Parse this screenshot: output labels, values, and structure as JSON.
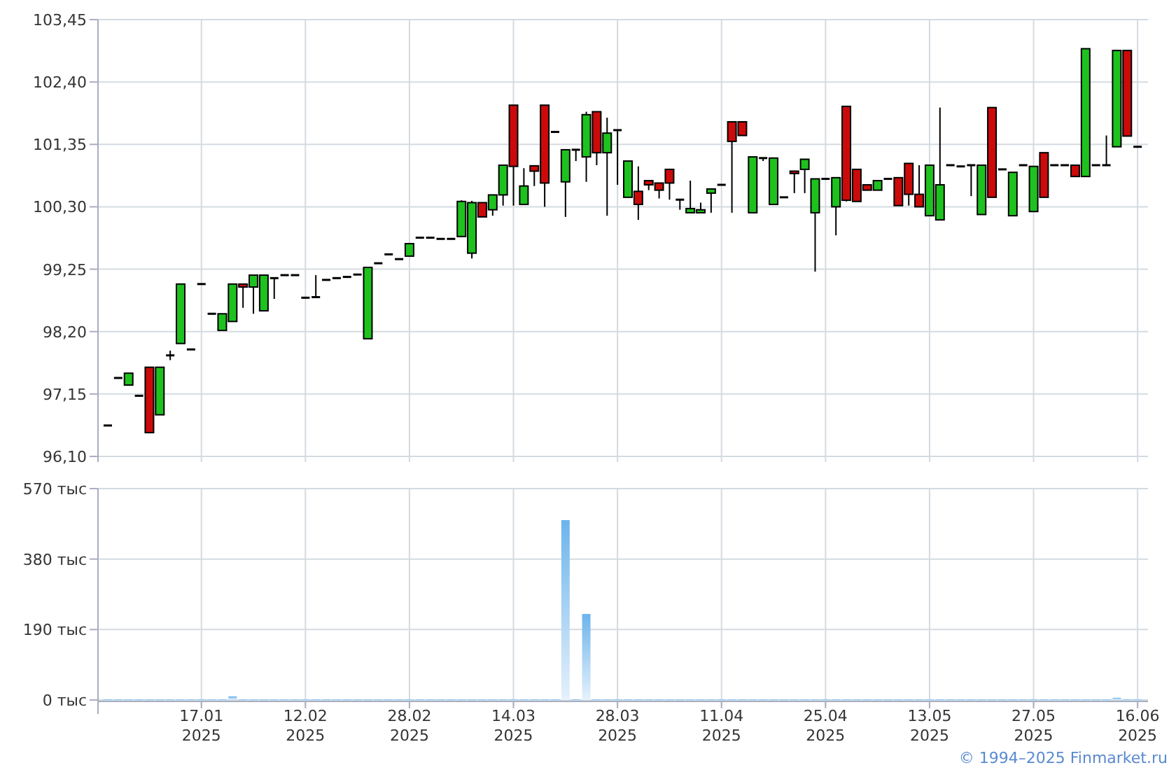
{
  "price_chart": {
    "chart_data": {
      "type": "candlestick",
      "grid": true,
      "ylim": [
        96.1,
        103.45
      ],
      "yticks": [
        {
          "value": 103.45,
          "label": "103,45"
        },
        {
          "value": 102.4,
          "label": "102,40"
        },
        {
          "value": 101.35,
          "label": "101,35"
        },
        {
          "value": 100.3,
          "label": "100,30"
        },
        {
          "value": 99.25,
          "label": "99,25"
        },
        {
          "value": 98.2,
          "label": "98,20"
        },
        {
          "value": 97.15,
          "label": "97,15"
        },
        {
          "value": 96.1,
          "label": "96,10"
        }
      ],
      "categories": [
        null,
        null,
        null,
        null,
        null,
        null,
        null,
        null,
        null,
        null,
        null,
        null,
        null,
        null,
        null,
        null,
        null,
        null,
        null,
        null,
        null,
        null,
        null,
        null,
        null,
        null,
        null,
        null,
        null,
        null,
        null,
        null,
        null,
        null,
        null,
        null,
        null,
        null,
        null,
        null,
        null,
        null,
        null,
        null,
        null,
        null,
        null,
        null,
        null,
        null,
        null,
        null,
        null,
        null,
        null,
        null,
        null,
        null,
        null,
        null,
        null,
        null,
        null,
        null,
        null,
        null,
        null,
        null,
        null,
        null,
        null,
        null,
        null,
        null,
        null,
        null,
        null,
        null,
        null,
        null,
        null,
        null,
        null,
        null,
        null,
        null,
        null,
        null,
        null,
        null,
        null,
        null,
        null,
        null,
        null,
        null,
        null,
        null,
        null,
        null
      ],
      "ohlc": [
        [
          96.62,
          96.62,
          96.62,
          96.62
        ],
        [
          97.42,
          97.42,
          97.42,
          97.42
        ],
        [
          97.3,
          97.5,
          97.3,
          97.5
        ],
        [
          97.12,
          97.12,
          97.12,
          97.12
        ],
        [
          97.6,
          97.6,
          96.5,
          96.5
        ],
        [
          96.8,
          97.6,
          96.8,
          97.6
        ],
        [
          97.8,
          97.88,
          97.72,
          97.8
        ],
        [
          98.0,
          99.0,
          98.0,
          99.0
        ],
        [
          97.9,
          97.9,
          97.9,
          97.9
        ],
        [
          99.0,
          99.0,
          99.0,
          99.0
        ],
        [
          98.5,
          98.5,
          98.5,
          98.5
        ],
        [
          98.22,
          98.5,
          98.22,
          98.5
        ],
        [
          98.37,
          99.0,
          98.37,
          99.0
        ],
        [
          99.0,
          99.0,
          98.6,
          98.95
        ],
        [
          98.95,
          99.15,
          98.5,
          99.15
        ],
        [
          98.55,
          99.15,
          98.55,
          99.15
        ],
        [
          99.1,
          99.1,
          98.75,
          99.1
        ],
        [
          99.15,
          99.15,
          99.15,
          99.15
        ],
        [
          99.15,
          99.15,
          99.15,
          99.15
        ],
        [
          98.77,
          98.77,
          98.77,
          98.77
        ],
        [
          98.78,
          99.15,
          98.78,
          98.78
        ],
        [
          99.07,
          99.07,
          99.07,
          99.07
        ],
        [
          99.1,
          99.1,
          99.1,
          99.1
        ],
        [
          99.12,
          99.12,
          99.12,
          99.12
        ],
        [
          99.16,
          99.16,
          99.16,
          99.16
        ],
        [
          98.08,
          99.28,
          98.08,
          99.28
        ],
        [
          99.35,
          99.35,
          99.35,
          99.35
        ],
        [
          99.5,
          99.5,
          99.5,
          99.5
        ],
        [
          99.42,
          99.42,
          99.42,
          99.42
        ],
        [
          99.47,
          99.68,
          99.47,
          99.68
        ],
        [
          99.78,
          99.78,
          99.78,
          99.78
        ],
        [
          99.78,
          99.78,
          99.78,
          99.78
        ],
        [
          99.76,
          99.76,
          99.76,
          99.76
        ],
        [
          99.76,
          99.76,
          99.76,
          99.76
        ],
        [
          99.8,
          100.41,
          99.8,
          100.39
        ],
        [
          99.52,
          100.4,
          99.43,
          100.37
        ],
        [
          100.37,
          100.37,
          100.13,
          100.13
        ],
        [
          100.25,
          100.5,
          100.15,
          100.5
        ],
        [
          100.5,
          101.0,
          100.32,
          101.0
        ],
        [
          102.01,
          102.01,
          100.32,
          100.98
        ],
        [
          100.34,
          100.95,
          100.34,
          100.65
        ],
        [
          100.99,
          101.0,
          100.65,
          100.9
        ],
        [
          102.01,
          102.01,
          100.3,
          100.7
        ],
        [
          101.56,
          101.56,
          101.56,
          101.56
        ],
        [
          100.72,
          101.26,
          100.13,
          101.26
        ],
        [
          101.26,
          101.26,
          101.07,
          101.26
        ],
        [
          101.14,
          101.9,
          100.72,
          101.85
        ],
        [
          101.9,
          101.9,
          101.0,
          101.21
        ],
        [
          101.21,
          101.8,
          100.15,
          101.54
        ],
        [
          101.59,
          101.59,
          100.67,
          101.59
        ],
        [
          100.46,
          101.07,
          100.46,
          101.07
        ],
        [
          100.56,
          100.98,
          100.08,
          100.34
        ],
        [
          100.74,
          100.74,
          100.58,
          100.67
        ],
        [
          100.7,
          100.7,
          100.44,
          100.58
        ],
        [
          100.93,
          100.93,
          100.42,
          100.7
        ],
        [
          100.42,
          100.42,
          100.25,
          100.42
        ],
        [
          100.2,
          100.74,
          100.2,
          100.27
        ],
        [
          100.2,
          100.37,
          100.2,
          100.25
        ],
        [
          100.53,
          100.6,
          100.2,
          100.6
        ],
        [
          100.67,
          100.67,
          100.67,
          100.67
        ],
        [
          101.73,
          101.73,
          100.2,
          101.4
        ],
        [
          101.73,
          101.73,
          101.5,
          101.5
        ],
        [
          100.2,
          101.14,
          100.2,
          101.14
        ],
        [
          101.12,
          101.12,
          101.07,
          101.12
        ],
        [
          100.34,
          101.12,
          100.34,
          101.12
        ],
        [
          100.46,
          100.46,
          100.46,
          100.46
        ],
        [
          100.9,
          100.9,
          100.53,
          100.86
        ],
        [
          100.93,
          101.1,
          100.53,
          101.1
        ],
        [
          100.2,
          100.77,
          99.21,
          100.77
        ],
        [
          100.77,
          100.77,
          100.77,
          100.77
        ],
        [
          100.3,
          100.79,
          99.82,
          100.79
        ],
        [
          101.99,
          101.99,
          100.39,
          100.41
        ],
        [
          100.93,
          100.93,
          100.39,
          100.39
        ],
        [
          100.67,
          100.67,
          100.58,
          100.58
        ],
        [
          100.58,
          100.74,
          100.58,
          100.74
        ],
        [
          100.77,
          100.77,
          100.77,
          100.77
        ],
        [
          100.79,
          100.79,
          100.32,
          100.32
        ],
        [
          101.03,
          101.03,
          100.32,
          100.51
        ],
        [
          100.51,
          101.0,
          100.3,
          100.3
        ],
        [
          100.15,
          101.0,
          100.15,
          101.0
        ],
        [
          100.08,
          101.97,
          100.08,
          100.67
        ],
        [
          101.0,
          101.0,
          101.0,
          101.0
        ],
        [
          100.98,
          100.98,
          100.98,
          100.98
        ],
        [
          101.0,
          101.0,
          100.48,
          101.0
        ],
        [
          100.17,
          101.0,
          100.17,
          101.0
        ],
        [
          101.97,
          101.97,
          100.46,
          100.46
        ],
        [
          100.93,
          100.93,
          100.93,
          100.93
        ],
        [
          100.15,
          100.88,
          100.15,
          100.88
        ],
        [
          101.0,
          101.0,
          101.0,
          101.0
        ],
        [
          100.22,
          100.98,
          100.22,
          100.98
        ],
        [
          101.21,
          101.21,
          100.46,
          100.46
        ],
        [
          101.0,
          101.0,
          101.0,
          101.0
        ],
        [
          101.0,
          101.0,
          101.0,
          101.0
        ],
        [
          101.0,
          101.0,
          100.81,
          100.81
        ],
        [
          100.81,
          102.96,
          100.81,
          102.96
        ],
        [
          101.0,
          101.0,
          101.0,
          101.0
        ],
        [
          101.0,
          101.5,
          101.0,
          101.0
        ],
        [
          101.31,
          102.93,
          101.31,
          102.93
        ],
        [
          102.93,
          102.93,
          101.49,
          101.49
        ],
        [
          101.31,
          101.31,
          101.31,
          101.31
        ]
      ]
    }
  },
  "volume_chart": {
    "chart_data": {
      "type": "bar",
      "grid": true,
      "ylim": [
        0,
        570
      ],
      "yticks": [
        {
          "value": 570,
          "label": "570 тыс"
        },
        {
          "value": 380,
          "label": "380 тыс"
        },
        {
          "value": 190,
          "label": "190 тыс"
        },
        {
          "value": 0,
          "label": "0 тыс"
        }
      ],
      "categories": [
        null,
        null,
        null,
        null,
        null,
        null,
        null,
        null,
        null,
        "17.01\n2025",
        null,
        null,
        null,
        null,
        null,
        null,
        null,
        null,
        null,
        "12.02\n2025",
        null,
        null,
        null,
        null,
        null,
        null,
        null,
        null,
        null,
        "28.02\n2025",
        null,
        null,
        null,
        null,
        null,
        null,
        null,
        null,
        null,
        "14.03\n2025",
        null,
        null,
        null,
        null,
        null,
        null,
        null,
        null,
        null,
        "28.03\n2025",
        null,
        null,
        null,
        null,
        null,
        null,
        null,
        null,
        null,
        "11.04\n2025",
        null,
        null,
        null,
        null,
        null,
        null,
        null,
        null,
        null,
        "25.04\n2025",
        null,
        null,
        null,
        null,
        null,
        null,
        null,
        null,
        null,
        "13.05\n2025",
        null,
        null,
        null,
        null,
        null,
        null,
        null,
        null,
        null,
        "27.05\n2025",
        null,
        null,
        null,
        null,
        null,
        null,
        null,
        null,
        null,
        "16.06\n2025"
      ],
      "series": [
        {
          "color": "#6cb4ec",
          "values": [
            2,
            2,
            2,
            2,
            2,
            2,
            2,
            2,
            2,
            2,
            2,
            2,
            10,
            2,
            2,
            2,
            2,
            2,
            2,
            2,
            2,
            2,
            2,
            2,
            2,
            2,
            2,
            2,
            2,
            2,
            2,
            2,
            2,
            2,
            2,
            2,
            2,
            2,
            2,
            2,
            2,
            2,
            2,
            2,
            485,
            2,
            232,
            2,
            2,
            2,
            2,
            2,
            2,
            2,
            2,
            2,
            2,
            2,
            2,
            2,
            2,
            2,
            2,
            2,
            2,
            2,
            2,
            2,
            2,
            2,
            2,
            2,
            2,
            2,
            2,
            2,
            2,
            2,
            2,
            2,
            2,
            2,
            2,
            2,
            2,
            2,
            2,
            2,
            2,
            2,
            2,
            2,
            2,
            2,
            2,
            2,
            2,
            6,
            2,
            2
          ]
        }
      ]
    }
  },
  "copyright": "© 1994–2025 Finmarket.ru"
}
